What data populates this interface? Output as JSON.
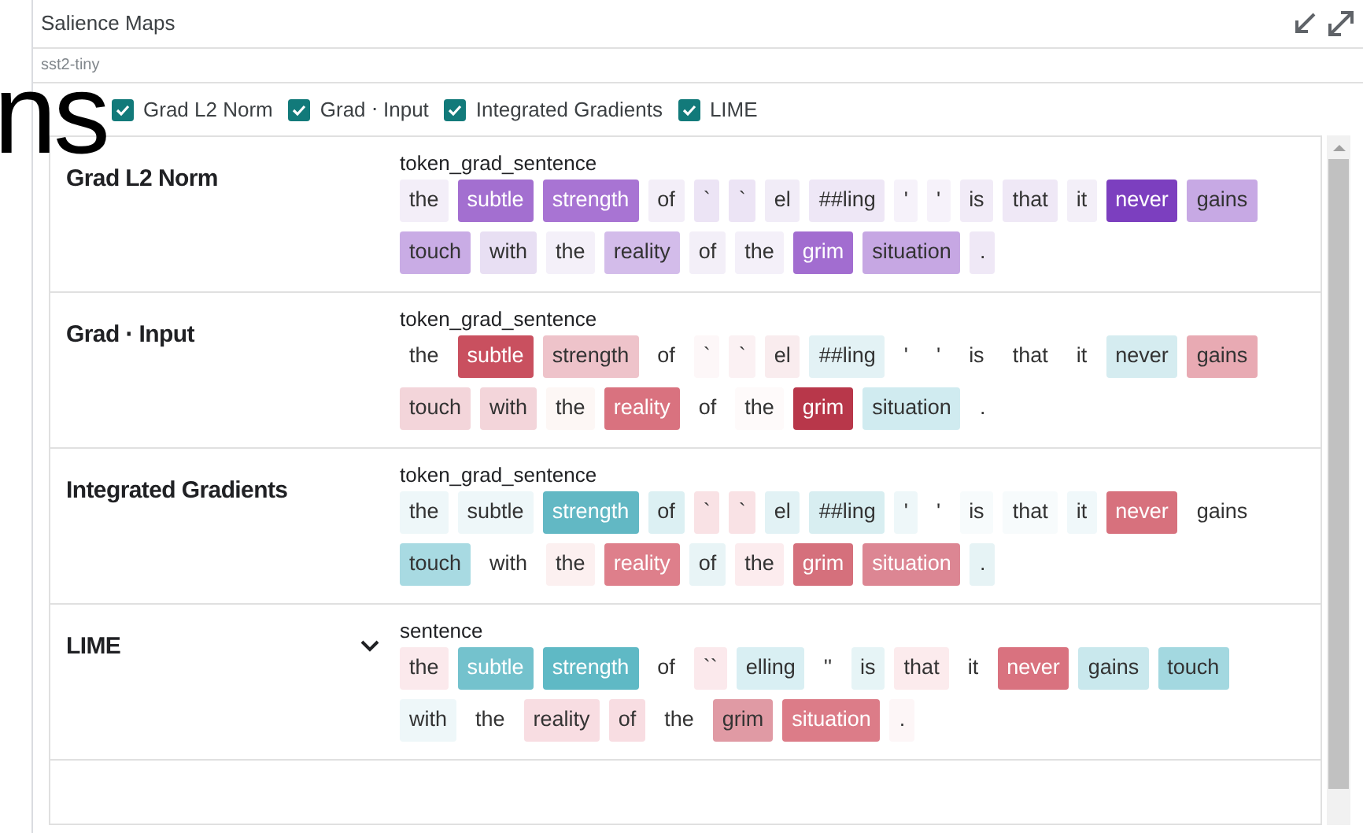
{
  "overlay_text": "ns",
  "panel": {
    "title": "Salience Maps",
    "subtitle": "sst2-tiny"
  },
  "methods": [
    {
      "label": "Grad L2 Norm",
      "checked": true
    },
    {
      "label": "Grad ⋅ Input",
      "checked": true
    },
    {
      "label": "Integrated Gradients",
      "checked": true
    },
    {
      "label": "LIME",
      "checked": true
    }
  ],
  "rows": [
    {
      "method": "Grad L2 Norm",
      "expanded": false,
      "field": "token_grad_sentence",
      "tokens": [
        {
          "text": "the",
          "color": "#f3eef8"
        },
        {
          "text": "subtle",
          "color": "#a36fd0"
        },
        {
          "text": "strength",
          "color": "#a874d3"
        },
        {
          "text": "of",
          "color": "#f3eef8"
        },
        {
          "text": "`",
          "color": "#ece4f5"
        },
        {
          "text": "`",
          "color": "#ece4f5"
        },
        {
          "text": "el",
          "color": "#f1ecf7"
        },
        {
          "text": "##ling",
          "color": "#eee7f6"
        },
        {
          "text": "'",
          "color": "#f6f2fa"
        },
        {
          "text": "'",
          "color": "#f6f2fa"
        },
        {
          "text": "is",
          "color": "#f1ebf7"
        },
        {
          "text": "that",
          "color": "#efe8f6"
        },
        {
          "text": "it",
          "color": "#f3eff8"
        },
        {
          "text": "never",
          "color": "#7c3fbf"
        },
        {
          "text": "gains",
          "color": "#c7a9e4"
        },
        {
          "text": "touch",
          "color": "#c9ace5"
        },
        {
          "text": "with",
          "color": "#e8dff3"
        },
        {
          "text": "the",
          "color": "#f4f0f9"
        },
        {
          "text": "reality",
          "color": "#d3bcea"
        },
        {
          "text": "of",
          "color": "#f3eff8"
        },
        {
          "text": "the",
          "color": "#f4f0f9"
        },
        {
          "text": "grim",
          "color": "#a26dd0"
        },
        {
          "text": "situation",
          "color": "#c6a7e3"
        },
        {
          "text": ".",
          "color": "#efe8f6"
        }
      ]
    },
    {
      "method": "Grad ⋅ Input",
      "expanded": false,
      "field": "token_grad_sentence",
      "tokens": [
        {
          "text": "the",
          "color": "#ffffff"
        },
        {
          "text": "subtle",
          "color": "#c9505f"
        },
        {
          "text": "strength",
          "color": "#eec3ca"
        },
        {
          "text": "of",
          "color": "#ffffff"
        },
        {
          "text": "`",
          "color": "#fdf7f8"
        },
        {
          "text": "`",
          "color": "#fbf1f3"
        },
        {
          "text": "el",
          "color": "#f9ecee"
        },
        {
          "text": "##ling",
          "color": "#e3f2f5"
        },
        {
          "text": "'",
          "color": "#ffffff"
        },
        {
          "text": "'",
          "color": "#ffffff"
        },
        {
          "text": "is",
          "color": "#ffffff"
        },
        {
          "text": "that",
          "color": "#ffffff"
        },
        {
          "text": "it",
          "color": "#ffffff"
        },
        {
          "text": "never",
          "color": "#d5ecf0"
        },
        {
          "text": "gains",
          "color": "#e8aab3"
        },
        {
          "text": "touch",
          "color": "#f3d5da"
        },
        {
          "text": "with",
          "color": "#f3d5da"
        },
        {
          "text": "the",
          "color": "#fdf7f5"
        },
        {
          "text": "reality",
          "color": "#d9727f"
        },
        {
          "text": "of",
          "color": "#ffffff"
        },
        {
          "text": "the",
          "color": "#fefafa"
        },
        {
          "text": "grim",
          "color": "#b8374a"
        },
        {
          "text": "situation",
          "color": "#d0ebf0"
        },
        {
          "text": ".",
          "color": "#ffffff"
        }
      ]
    },
    {
      "method": "Integrated Gradients",
      "expanded": false,
      "field": "token_grad_sentence",
      "tokens": [
        {
          "text": "the",
          "color": "#eef7f9"
        },
        {
          "text": "subtle",
          "color": "#eef7f9"
        },
        {
          "text": "strength",
          "color": "#62b8c4"
        },
        {
          "text": "of",
          "color": "#dcf0f3"
        },
        {
          "text": "`",
          "color": "#f9e2e5"
        },
        {
          "text": "`",
          "color": "#f9e2e5"
        },
        {
          "text": "el",
          "color": "#e2f2f5"
        },
        {
          "text": "##ling",
          "color": "#d8eef1"
        },
        {
          "text": "'",
          "color": "#eef7f9"
        },
        {
          "text": "'",
          "color": "#ffffff"
        },
        {
          "text": "is",
          "color": "#f7fbfc"
        },
        {
          "text": "that",
          "color": "#f7fbfc"
        },
        {
          "text": "it",
          "color": "#f0f8fa"
        },
        {
          "text": "never",
          "color": "#d7717d"
        },
        {
          "text": "gains",
          "color": "#ffffff"
        },
        {
          "text": "touch",
          "color": "#a8dae2"
        },
        {
          "text": "with",
          "color": "#ffffff"
        },
        {
          "text": "the",
          "color": "#fcf0f0"
        },
        {
          "text": "reality",
          "color": "#de7f8b"
        },
        {
          "text": "of",
          "color": "#e8f4f6"
        },
        {
          "text": "the",
          "color": "#fcecee"
        },
        {
          "text": "grim",
          "color": "#d5707c"
        },
        {
          "text": "situation",
          "color": "#dc8693"
        },
        {
          "text": ".",
          "color": "#e6f3f5"
        }
      ]
    },
    {
      "method": "LIME",
      "expanded": true,
      "field": "sentence",
      "tokens": [
        {
          "text": "the",
          "color": "#fbe9ec"
        },
        {
          "text": "subtle",
          "color": "#74c2cd"
        },
        {
          "text": "strength",
          "color": "#5fb9c5"
        },
        {
          "text": "of",
          "color": "#ffffff"
        },
        {
          "text": "``",
          "color": "#fbe9ec"
        },
        {
          "text": "elling",
          "color": "#d9eff3"
        },
        {
          "text": "''",
          "color": "#ffffff"
        },
        {
          "text": "is",
          "color": "#e6f4f6"
        },
        {
          "text": "that",
          "color": "#fcebed"
        },
        {
          "text": "it",
          "color": "#ffffff"
        },
        {
          "text": "never",
          "color": "#d9727f"
        },
        {
          "text": "gains",
          "color": "#c9e8ed"
        },
        {
          "text": "touch",
          "color": "#a3d8e0"
        },
        {
          "text": "with",
          "color": "#eef7f9"
        },
        {
          "text": "the",
          "color": "#ffffff"
        },
        {
          "text": "reality",
          "color": "#f8dde2"
        },
        {
          "text": "of",
          "color": "#f8dde2"
        },
        {
          "text": "the",
          "color": "#ffffff"
        },
        {
          "text": "grim",
          "color": "#e09aa4"
        },
        {
          "text": "situation",
          "color": "#dc7c88"
        },
        {
          "text": ".",
          "color": "#fdf6f7"
        }
      ]
    }
  ]
}
